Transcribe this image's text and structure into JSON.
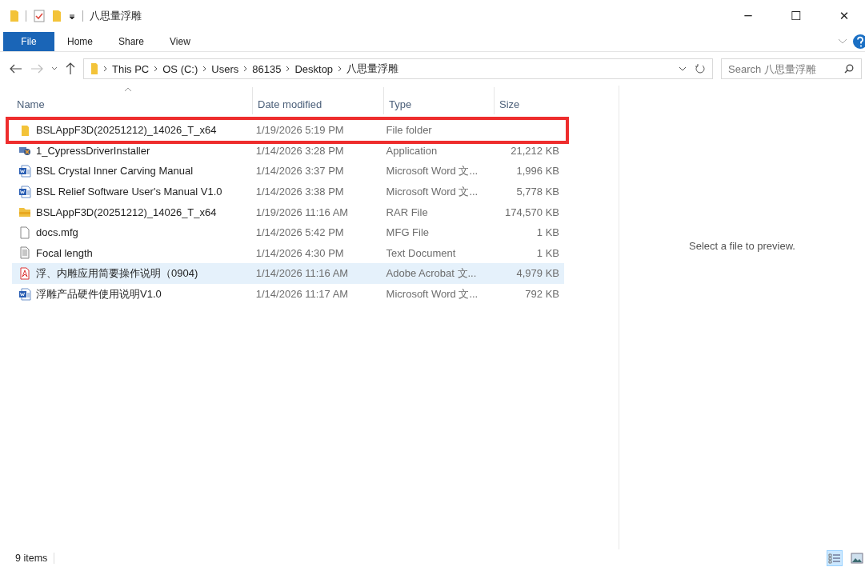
{
  "window": {
    "title": "八思量浮雕",
    "controls": [
      "─",
      "☐",
      "✕"
    ]
  },
  "ribbon": {
    "tabs": [
      {
        "label": "File",
        "selected": true
      },
      {
        "label": "Home",
        "selected": false
      },
      {
        "label": "Share",
        "selected": false
      },
      {
        "label": "View",
        "selected": false
      }
    ]
  },
  "address_bar": {
    "path": [
      "This PC",
      "OS (C:)",
      "Users",
      "86135",
      "Desktop",
      "八思量浮雕"
    ]
  },
  "search": {
    "placeholder": "Search 八思量浮雕"
  },
  "columns": [
    "Name",
    "Date modified",
    "Type",
    "Size"
  ],
  "rows": [
    {
      "kind": "folder",
      "name": "BSLAppF3D(20251212)_14026_T_x64",
      "date": "1/19/2026 5:19 PM",
      "type": "File folder",
      "size": "",
      "selected": false,
      "outlined": true
    },
    {
      "kind": "app",
      "name": "1_CypressDriverInstaller",
      "date": "1/14/2026 3:28 PM",
      "type": "Application",
      "size": "21,212 KB",
      "selected": false,
      "outlined": false
    },
    {
      "kind": "word",
      "name": "BSL Crystal Inner Carving Manual",
      "date": "1/14/2026 3:37 PM",
      "type": "Microsoft Word 文...",
      "size": "1,996 KB",
      "selected": false,
      "outlined": false
    },
    {
      "kind": "word",
      "name": "BSL Relief Software User's Manual V1.0",
      "date": "1/14/2026 3:38 PM",
      "type": "Microsoft Word 文...",
      "size": "5,778 KB",
      "selected": false,
      "outlined": false
    },
    {
      "kind": "rar",
      "name": "BSLAppF3D(20251212)_14026_T_x64",
      "date": "1/19/2026 11:16 AM",
      "type": "RAR File",
      "size": "174,570 KB",
      "selected": false,
      "outlined": false
    },
    {
      "kind": "file",
      "name": "docs.mfg",
      "date": "1/14/2026 5:42 PM",
      "type": "MFG File",
      "size": "1 KB",
      "selected": false,
      "outlined": false
    },
    {
      "kind": "text",
      "name": "Focal length",
      "date": "1/14/2026 4:30 PM",
      "type": "Text Document",
      "size": "1 KB",
      "selected": false,
      "outlined": false
    },
    {
      "kind": "pdf",
      "name": "浮、内雕应用简要操作说明（0904)",
      "date": "1/14/2026 11:16 AM",
      "type": "Adobe Acrobat 文...",
      "size": "4,979 KB",
      "selected": true,
      "outlined": false
    },
    {
      "kind": "word",
      "name": "浮雕产品硬件使用说明V1.0",
      "date": "1/14/2026 11:17 AM",
      "type": "Microsoft Word 文...",
      "size": "792 KB",
      "selected": false,
      "outlined": false
    }
  ],
  "preview": {
    "message": "Select a file to preview."
  },
  "status_bar": {
    "count": "9 items",
    "views": [
      {
        "kind": "details",
        "selected": true
      },
      {
        "kind": "large",
        "selected": false
      }
    ]
  }
}
